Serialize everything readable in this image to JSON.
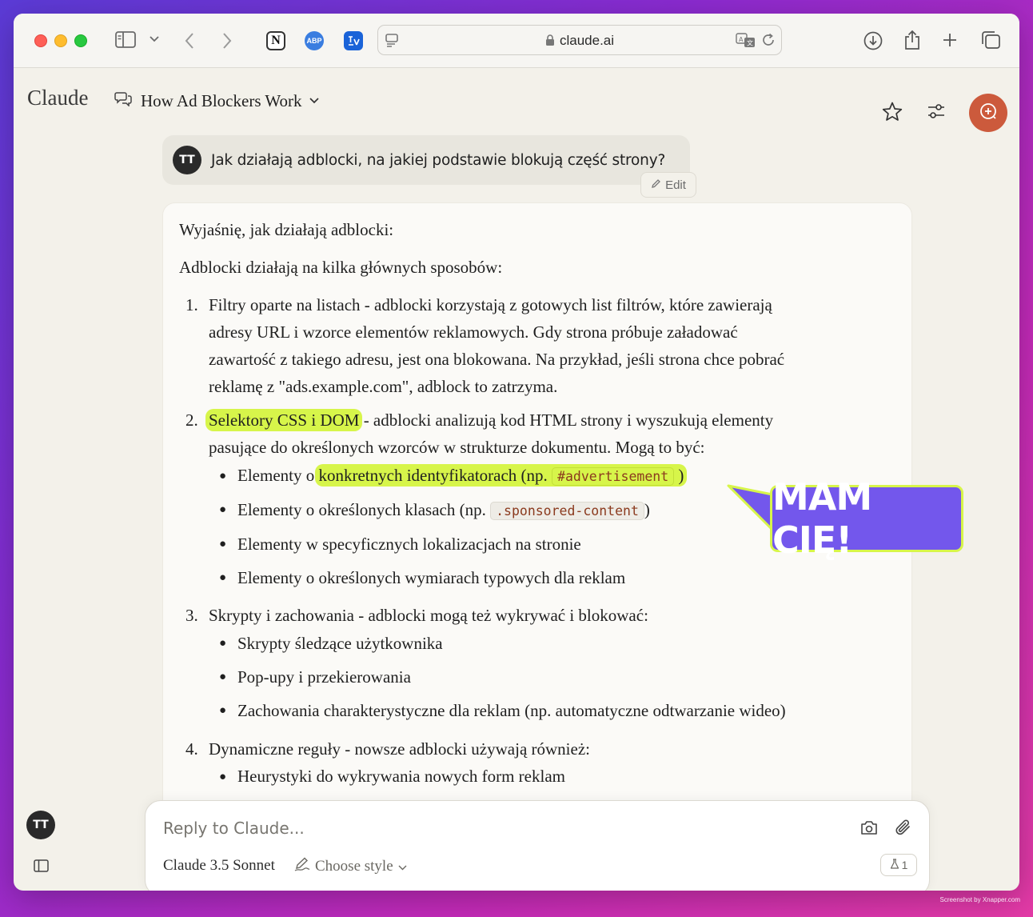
{
  "browser": {
    "url": "claude.ai",
    "extensions": [
      "notion-icon",
      "adblock-plus-icon",
      "translate-extension-icon"
    ],
    "abp_label": "ABP"
  },
  "app": {
    "brand": "Claude",
    "conversation_title": "How Ad Blockers Work",
    "user_initials": "TT",
    "accent": "#cc5a3c"
  },
  "user_message": {
    "text": "Jak działają adblocki, na jakiej podstawie blokują część strony?",
    "edit_label": "Edit"
  },
  "assistant": {
    "intro": "Wyjaśnię, jak działają adblocki:",
    "lead": "Adblocki działają na kilka głównych sposobów:",
    "items": [
      {
        "num": "1.",
        "lines": [
          "Filtry oparte na listach - adblocki korzystają z gotowych list filtrów, które zawierają",
          "adresy URL i wzorce elementów reklamowych. Gdy strona próbuje załadować",
          "zawartość z takiego adresu, jest ona blokowana. Na przykład, jeśli strona chce pobrać",
          "reklamę z \"ads.example.com\", adblock to zatrzyma."
        ]
      },
      {
        "num": "2.",
        "highlight": "Selektory CSS i DOM",
        "rest": " - adblocki analizują kod HTML strony i wyszukują elementy",
        "line2": "pasujące do określonych wzorców w strukturze dokumentu. Mogą to być:",
        "bullets": [
          {
            "pre": "Elementy o ",
            "hl": "konkretnych identyfikatorach (np. ",
            "code": "#advertisement",
            "post": ")"
          },
          {
            "pre": "Elementy o określonych klasach (np. ",
            "code": ".sponsored-content",
            "post": ")"
          },
          {
            "text": "Elementy w specyficznych lokalizacjach na stronie"
          },
          {
            "text": "Elementy o określonych wymiarach typowych dla reklam"
          }
        ]
      },
      {
        "num": "3.",
        "text": "Skrypty i zachowania - adblocki mogą też wykrywać i blokować:",
        "bullets": [
          "Skrypty śledzące użytkownika",
          "Pop-upy i przekierowania",
          "Zachowania charakterystyczne dla reklam (np. automatyczne odtwarzanie wideo)"
        ]
      },
      {
        "num": "4.",
        "text": "Dynamiczne reguły - nowsze adblocki używają również:",
        "bullets": [
          "Heurystyki do wykrywania nowych form reklam"
        ]
      }
    ]
  },
  "callout": {
    "text": "MAM CIĘ!",
    "color": "#7357ec",
    "highlight": "#d7f54a"
  },
  "composer": {
    "placeholder": "Reply to Claude...",
    "model": "Claude 3.5 Sonnet",
    "style": "Choose style",
    "counter": "1"
  },
  "credit": "Screenshot by Xnapper.com"
}
